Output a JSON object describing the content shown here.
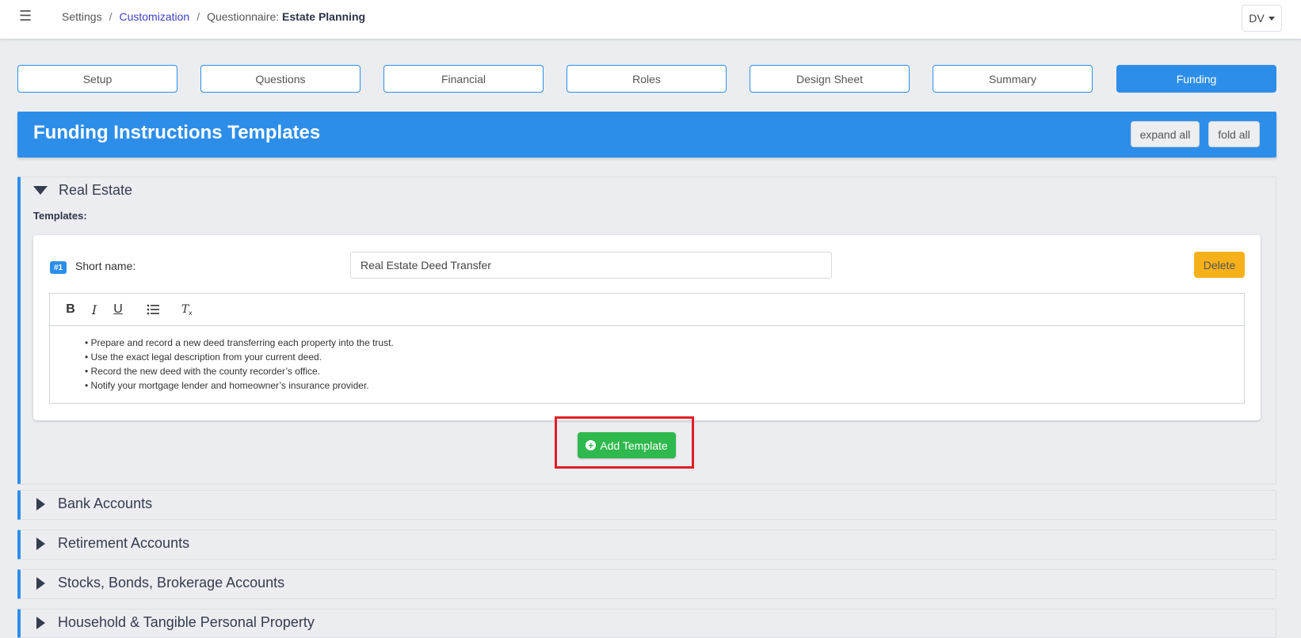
{
  "nav": {
    "menu_icon": "menu-icon",
    "breadcrumb": {
      "root": "Settings",
      "link": "Customization",
      "prefix": "Questionnaire:",
      "current": "Estate Planning"
    },
    "user_initials": "DV"
  },
  "tabs": [
    {
      "label": "Setup"
    },
    {
      "label": "Questions"
    },
    {
      "label": "Financial"
    },
    {
      "label": "Roles"
    },
    {
      "label": "Design Sheet"
    },
    {
      "label": "Summary"
    },
    {
      "label": "Funding",
      "active": true
    }
  ],
  "banner": {
    "title": "Funding Instructions Templates",
    "expand_label": "expand all",
    "fold_label": "fold all",
    "color": "#2d8eea"
  },
  "sections": [
    {
      "title": "Real Estate",
      "expanded": true,
      "templates_label": "Templates:",
      "template": {
        "badge": "#1",
        "short_name_label": "Short name:",
        "short_name_value": "Real Estate Deed Transfer",
        "delete_label": "Delete",
        "toolbar": [
          "B",
          "I",
          "U",
          "list-icon",
          "clear-format-icon"
        ],
        "lines": [
          "• Prepare and record a new deed transferring each property into the trust.",
          "• Use the exact legal description from your current deed.",
          "• Record the new deed with the county recorder’s office.",
          "• Notify your mortgage lender and homeowner’s insurance provider."
        ]
      },
      "add_label": "Add Template"
    },
    {
      "title": "Bank Accounts",
      "expanded": false
    },
    {
      "title": "Retirement Accounts",
      "expanded": false
    },
    {
      "title": "Stocks, Bonds, Brokerage Accounts",
      "expanded": false
    },
    {
      "title": "Household & Tangible Personal Property",
      "expanded": false
    }
  ],
  "colors": {
    "accent": "#2d8eea",
    "success": "#2fb84d",
    "warning": "#f6b11a",
    "highlight": "#e01e26"
  }
}
